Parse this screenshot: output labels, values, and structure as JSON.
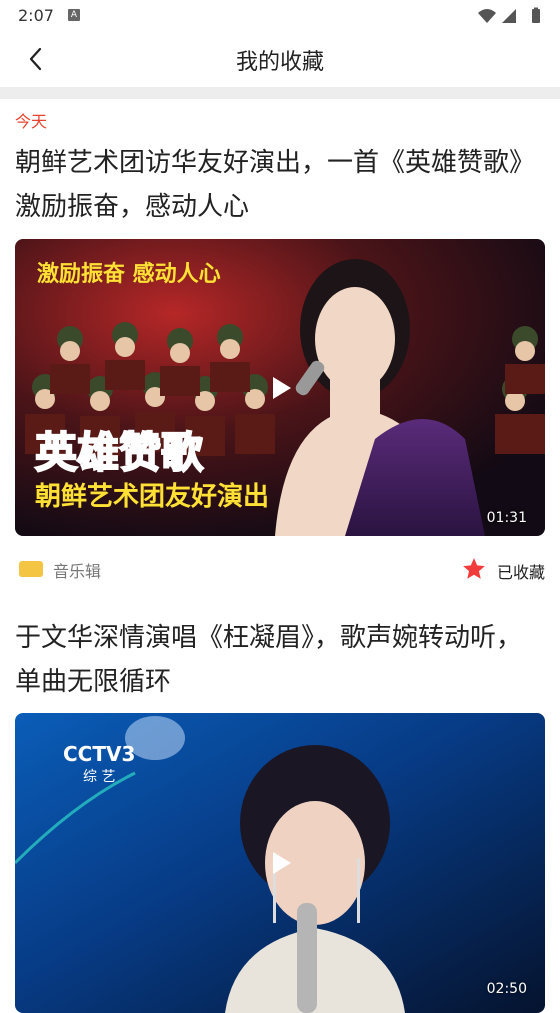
{
  "status_bar": {
    "time": "2:07",
    "notification_icon": "A"
  },
  "header": {
    "title": "我的收藏"
  },
  "feed": {
    "date_label": "今天",
    "items": [
      {
        "title": "朝鲜艺术团访华友好演出，一首《英雄赞歌》激励振奋，感动人心",
        "thumb_caption_top": "激励振奋  感动人心",
        "thumb_caption_main": "英雄赞歌",
        "thumb_caption_sub": "朝鲜艺术团友好演出",
        "duration": "01:31",
        "source": "音乐辑",
        "fav_label": "已收藏"
      },
      {
        "title": "于文华深情演唱《枉凝眉》，歌声婉转动听，单曲无限循环",
        "thumb_logo": "CCTV3",
        "thumb_logo_sub": "综 艺",
        "duration": "02:50"
      }
    ]
  },
  "colors": {
    "accent_red": "#e8432e",
    "star_red": "#f23b3b"
  }
}
